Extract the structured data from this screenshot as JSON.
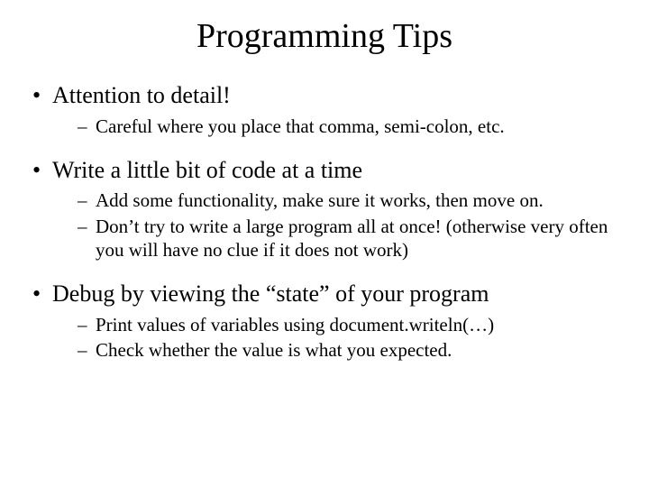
{
  "title": "Programming Tips",
  "b1": {
    "text": "Attention to detail!",
    "s1": "Careful where you place that comma, semi-colon, etc."
  },
  "b2": {
    "text": "Write a little bit of code at a time",
    "s1": "Add some functionality, make sure it works, then move on.",
    "s2": "Don’t try to write a large program all at once! (otherwise very often you will have no clue if it does not work)"
  },
  "b3": {
    "text": "Debug by viewing the “state” of your program",
    "s1": "Print values of variables using document.writeln(…)",
    "s2": "Check whether the value is what you expected."
  }
}
